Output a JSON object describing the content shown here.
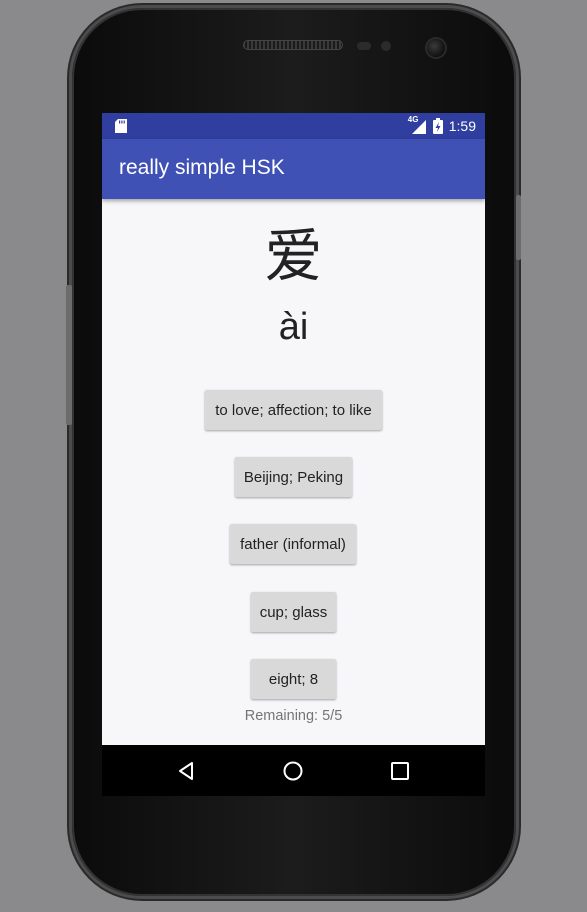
{
  "status_bar": {
    "network": "4G",
    "time": "1:59"
  },
  "app_bar": {
    "title": "really simple HSK"
  },
  "card": {
    "character": "爱",
    "pinyin": "ài"
  },
  "answers": [
    {
      "label": "to love; affection; to like"
    },
    {
      "label": "Beijing; Peking"
    },
    {
      "label": "father (informal)"
    },
    {
      "label": "cup; glass"
    },
    {
      "label": "eight; 8"
    }
  ],
  "remaining": "Remaining: 5/5",
  "nav_bar": {
    "buttons": [
      "back-icon",
      "home-icon",
      "recents-icon"
    ]
  },
  "colors": {
    "status_bar": "#303f9f",
    "app_bar": "#3f51b5",
    "button": "#d9d9d9",
    "background": "#f7f7fa"
  }
}
